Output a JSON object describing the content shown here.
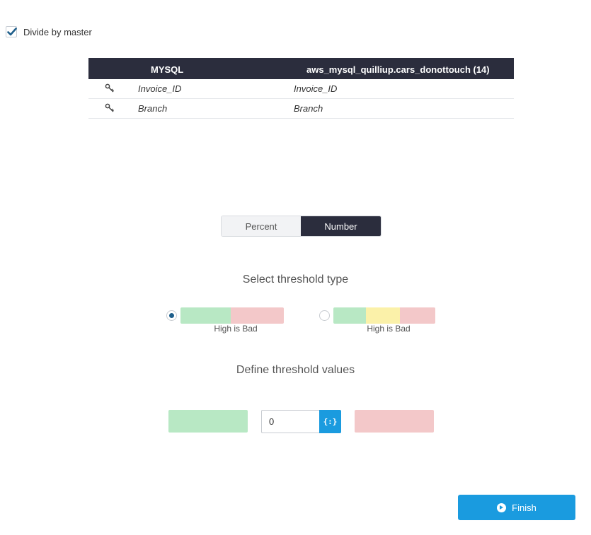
{
  "options": {
    "divide_by_master_label": "Divide by master",
    "divide_by_master_checked": true
  },
  "mapping": {
    "headers": [
      "MYSQL",
      "aws_mysql_quilliup.cars_donottouch (14)"
    ],
    "rows": [
      {
        "icon": "key-icon",
        "left": "Invoice_ID",
        "right": "Invoice_ID"
      },
      {
        "icon": "key-icon",
        "left": "Branch",
        "right": "Branch"
      }
    ]
  },
  "mode_toggle": {
    "options": [
      "Percent",
      "Number"
    ],
    "selected": "Number"
  },
  "threshold_type": {
    "title": "Select threshold type",
    "options": [
      {
        "caption": "High is Bad",
        "selected": true,
        "segments": [
          "green",
          "red"
        ]
      },
      {
        "caption": "High is Bad",
        "selected": false,
        "segments": [
          "green",
          "yellow",
          "red"
        ]
      }
    ]
  },
  "threshold_values": {
    "title": "Define threshold values",
    "input_value": "0",
    "variable_button": "{:}"
  },
  "finish_button": {
    "label": "Finish"
  },
  "colors": {
    "dark": "#2b2d3d",
    "accent": "#1a9bdf",
    "green": "#b8e8c4",
    "red": "#f3c8c9",
    "yellow": "#fbf1a9"
  }
}
